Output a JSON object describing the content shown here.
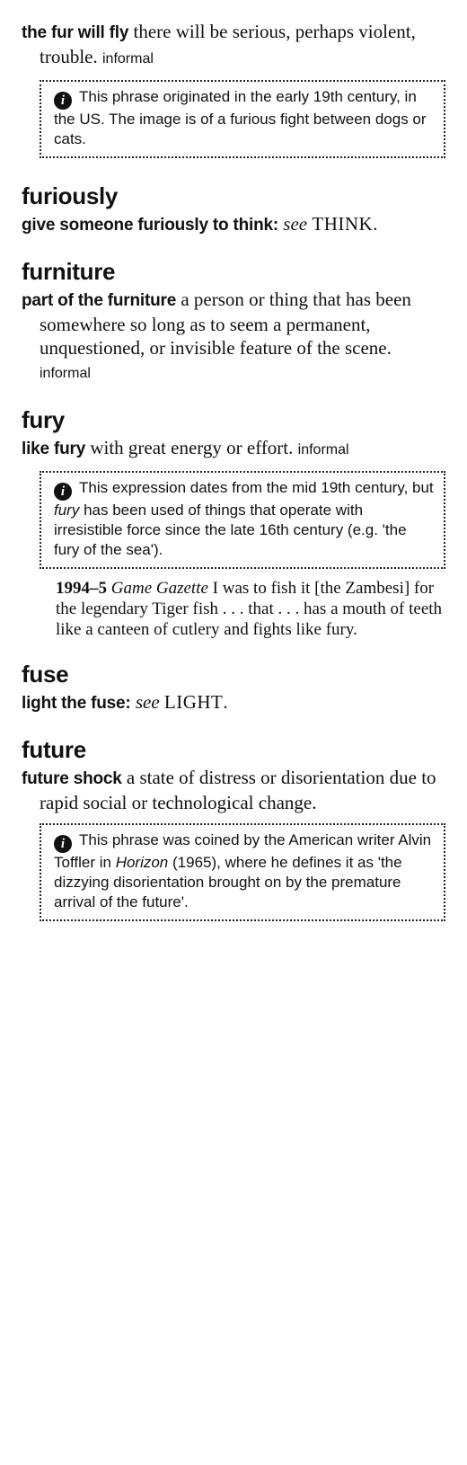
{
  "entries": [
    {
      "headword": "",
      "phrase": "the fur will fly",
      "definition": "there will be serious, perhaps violent, trouble.",
      "label": "informal",
      "note_pre": "This phrase originated in the early 19th century, in the US. The image is of a furious fight between dogs or cats."
    },
    {
      "headword": "furiously",
      "phrase": "give someone furiously to think",
      "see_word": "see",
      "see_target": "THINK"
    },
    {
      "headword": "furniture",
      "phrase": "part of the furniture",
      "definition": "a person or thing that has been somewhere so long as to seem a permanent, unquestioned, or invisible feature of the scene.",
      "label": "informal"
    },
    {
      "headword": "fury",
      "phrase": "like fury",
      "definition": "with great energy or effort.",
      "label": "informal",
      "note_pre": "This expression dates from the mid 19th century, but",
      "note_italic": "fury",
      "note_post": "has been used of things that operate with irresistible force since the late 16th century (e.g. 'the fury of the sea').",
      "quote_year": "1994–5",
      "quote_source": "Game Gazette",
      "quote_text": "I was to fish it [the Zambesi] for the legendary Tiger fish . . . that . . . has a mouth of teeth like a canteen of cutlery and fights like fury."
    },
    {
      "headword": "fuse",
      "phrase": "light the fuse",
      "see_word": "see",
      "see_target": "LIGHT"
    },
    {
      "headword": "future",
      "phrase": "future shock",
      "definition": "a state of distress or disorientation due to rapid social or technological change.",
      "note_pre": "This phrase was coined by the American writer Alvin Toffler in",
      "note_italic": "Horizon",
      "note_post": "(1965), where he defines it as 'the dizzying disorientation brought on by the premature arrival of the future'."
    }
  ],
  "icons": {
    "info": "i"
  }
}
